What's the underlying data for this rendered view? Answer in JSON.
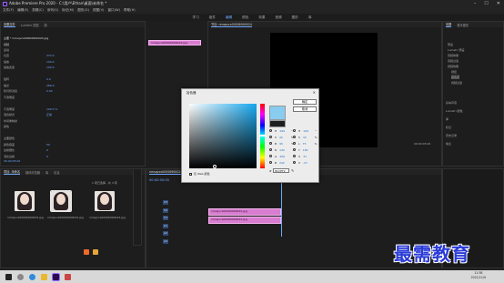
{
  "window": {
    "title": "Adobe Premiere Pro 2020 - C:\\用户\\Ethan\\桌面\\未命名 *"
  },
  "menu": [
    "文件(F)",
    "编辑(E)",
    "剪辑(C)",
    "序列(S)",
    "标记(M)",
    "图形(G)",
    "视图(V)",
    "窗口(W)",
    "帮助(H)"
  ],
  "workspaces": {
    "items": [
      "学习",
      "组件",
      "编辑",
      "颜色",
      "效果",
      "音频",
      "图形",
      "库"
    ],
    "active_index": 2
  },
  "effect_controls": {
    "tabs": [
      "效果控件",
      "Lumetri 范围",
      "源"
    ],
    "source_label": "主要 * nmsqvcs00006900024.jpg",
    "clip_label": "nmsqvcs00006900024.jpg",
    "section_video": "视频",
    "rows": [
      "运动",
      "位置",
      "缩放",
      "缩放宽度",
      "",
      "旋转",
      "锚点",
      "防闪烁滤镜",
      "不透明度",
      "",
      "不透明度",
      "混合模式",
      "时间重映射",
      "颜色",
      "",
      "主要颜色",
      "颜色容差",
      "边缘细化",
      "羽化边缘"
    ],
    "values": [
      "",
      "272.0",
      "100.0",
      "100.0",
      "",
      "0.0",
      "266.0",
      "0.00",
      "",
      "",
      "100.0 %",
      "正常",
      "",
      "",
      "",
      "",
      "50",
      "0",
      "0"
    ],
    "timecode": "00:00:05:00"
  },
  "project": {
    "tabs": [
      "项目: 未命名",
      "媒体浏览器",
      "库",
      "信息"
    ],
    "count_label": "1 项已选择，共 3 项",
    "items": [
      {
        "name": "nmsqvcs00006900002.jpg",
        "duration": "5:00"
      },
      {
        "name": "nmsqvcs00006900022.jpg",
        "duration": "5:00"
      },
      {
        "name": "nmsqvcs00006900024.jpg",
        "duration": "5:00"
      }
    ]
  },
  "program_monitor": {
    "title": "节目: nmsqvcs00006900024",
    "timecode_left": "00:00:05:00",
    "fit": "适合",
    "quality": "完整",
    "timecode_right": "00:00:05:00"
  },
  "timeline": {
    "tab": "nmsqvcs00006900024",
    "timecode": "00:00:05:00",
    "ruler": [
      "00:00",
      "00:00:05:00",
      "00:00:10:00"
    ],
    "tracks": [
      "V3",
      "V2",
      "V1",
      "A1",
      "A2",
      "A3"
    ],
    "clips": [
      {
        "label": "nmsqvcs00006900024.jpg"
      },
      {
        "label": "nmsqvcs00006900024.jpg"
      }
    ]
  },
  "color_picker": {
    "title": "拾色器",
    "ok": "确定",
    "cancel": "取消",
    "web_only": "仅 Web 颜色",
    "fields": [
      {
        "k": "H",
        "v": "199",
        "u": "°"
      },
      {
        "k": "S",
        "v": "42",
        "u": "%"
      },
      {
        "k": "B",
        "v": "95",
        "u": "%"
      },
      {
        "k": "R",
        "v": "140",
        "u": ""
      },
      {
        "k": "G",
        "v": "206",
        "u": ""
      },
      {
        "k": "B",
        "v": "242",
        "u": ""
      }
    ],
    "fields_right": [
      {
        "k": "H",
        "v": "199",
        "u": "°"
      },
      {
        "k": "S",
        "v": "42",
        "u": "%"
      },
      {
        "k": "L",
        "v": "75",
        "u": "%"
      },
      {
        "k": "Y",
        "v": "182",
        "u": ""
      },
      {
        "k": "U",
        "v": "31",
        "u": ""
      },
      {
        "k": "V",
        "v": "-27",
        "u": ""
      }
    ],
    "hex_label": "#",
    "hex_value": "8CCEF2",
    "current_color": "#88ccf0"
  },
  "effects_panel": {
    "tabs": [
      "效果",
      "基本图形"
    ],
    "tree": [
      "预设",
      "Lumetri 预设",
      "音频效果",
      "音频过渡",
      "视频效果",
      "键控",
      "颜色键",
      "视频过渡"
    ]
  },
  "right_rail": [
    "基本声音",
    "Lumetri 颜色",
    "库",
    "标记",
    "历史记录",
    "信息"
  ],
  "taskbar": {
    "time": "11:38",
    "date": "2021/11/9"
  },
  "watermark": "最需教育"
}
